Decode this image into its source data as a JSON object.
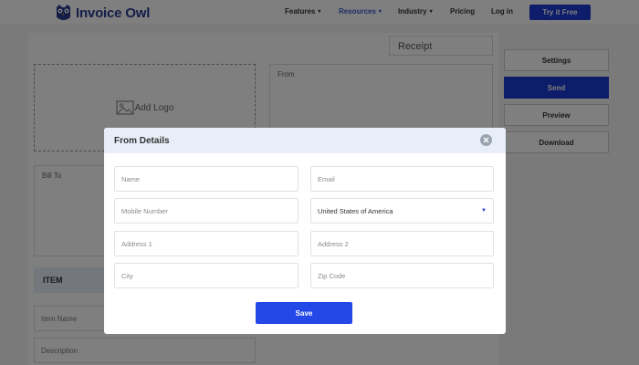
{
  "nav": {
    "brand": "Invoice Owl",
    "items": [
      {
        "label": "Features",
        "caret": "▾"
      },
      {
        "label": "Resources",
        "caret": "▾"
      },
      {
        "label": "Industry",
        "caret": "▾"
      },
      {
        "label": "Pricing"
      },
      {
        "label": "Log in"
      }
    ],
    "cta": "Try it Free"
  },
  "editor": {
    "doc_type": "Receipt",
    "add_logo": "Add Logo",
    "from_label": "From",
    "bill_to_label": "Bill To",
    "item_header": "ITEM",
    "item_name_placeholder": "Item Name",
    "description_placeholder": "Description"
  },
  "sidebar": {
    "buttons": [
      "Settings",
      "Send",
      "Preview",
      "Download"
    ]
  },
  "modal": {
    "title": "From Details",
    "fields": {
      "name": "Name",
      "email": "Email",
      "mobile": "Mobile Number",
      "country": "United States of America",
      "address1": "Address 1",
      "address2": "Address 2",
      "city": "City",
      "zip": "Zip Code"
    },
    "save": "Save"
  },
  "colors": {
    "brand": "#2a3a8f",
    "primary": "#1c3ad2",
    "save": "#2447e8",
    "header_bg": "#e8eef8"
  }
}
